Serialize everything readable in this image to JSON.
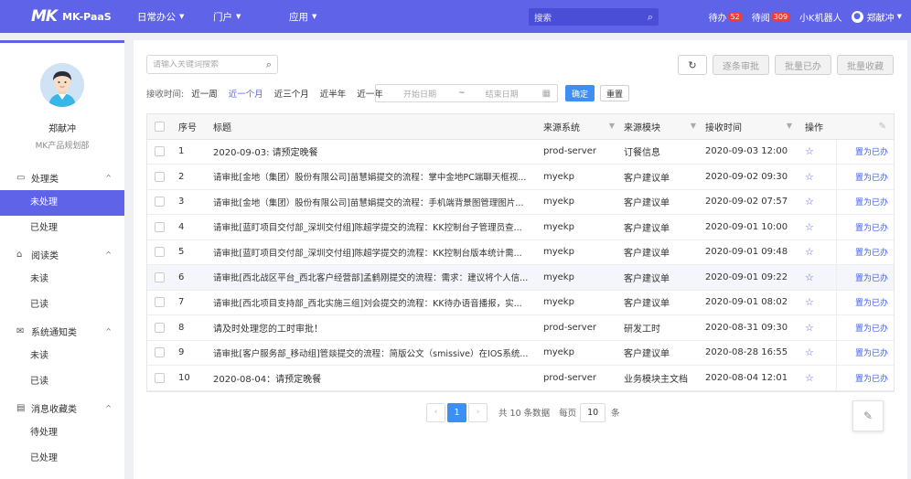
{
  "topbar": {
    "logo_mark": "MK",
    "logo_text": "MK-PaaS",
    "nav": [
      "日常办公",
      "门户",
      "应用"
    ],
    "search_placeholder": "搜索",
    "todo_label": "待办",
    "todo_count": "52",
    "toread_label": "待阅",
    "toread_count": "309",
    "robot_label": "小K机器人",
    "user_name": "郑献冲",
    "accent": "#5f63e8"
  },
  "profile": {
    "name": "郑献冲",
    "dept": "MK产品规划部"
  },
  "sidebar": {
    "groups": [
      {
        "icon": "monitor-icon",
        "label": "处理类",
        "items": [
          "未处理",
          "已处理"
        ]
      },
      {
        "icon": "home-icon",
        "label": "阅读类",
        "items": [
          "未读",
          "已读"
        ]
      },
      {
        "icon": "mail-icon",
        "label": "系统通知类",
        "items": [
          "未读",
          "已读"
        ]
      },
      {
        "icon": "doc-icon",
        "label": "消息收藏类",
        "items": [
          "待处理",
          "已处理"
        ]
      }
    ],
    "active": "未处理"
  },
  "toolbar": {
    "search_placeholder": "请输入关键词搜索",
    "btn_approve": "逐条审批",
    "btn_batch_done": "批量已办",
    "btn_batch_fav": "批量收藏"
  },
  "filter": {
    "label": "接收时间:",
    "options": [
      "近一周",
      "近一个月",
      "近三个月",
      "近半年",
      "近一年"
    ],
    "active": "近一个月",
    "start_placeholder": "开始日期",
    "separator": "~",
    "end_placeholder": "结束日期",
    "confirm": "确定",
    "reset": "重置"
  },
  "table": {
    "headers": [
      "序号",
      "标题",
      "来源系统",
      "来源模块",
      "接收时间",
      "操作"
    ],
    "rows": [
      {
        "idx": "1",
        "title": "2020-09-03: 请预定晚餐",
        "system": "prod-server",
        "module": "订餐信息",
        "time": "2020-09-03 12:00",
        "action": "置为已办"
      },
      {
        "idx": "2",
        "title": "请审批[金地（集团）股份有限公司]苗慧娟提交的流程：掌中金地PC端聊天框视...",
        "system": "myekp",
        "module": "客户建议单",
        "time": "2020-09-02 09:30",
        "action": "置为已办"
      },
      {
        "idx": "3",
        "title": "请审批[金地（集团）股份有限公司]苗慧娟提交的流程：手机端背景图管理图片...",
        "system": "myekp",
        "module": "客户建议单",
        "time": "2020-09-02 07:57",
        "action": "置为已办"
      },
      {
        "idx": "4",
        "title": "请审批[蓝盯项目交付部_深圳交付组]陈超学提交的流程：KK控制台子管理员查...",
        "system": "myekp",
        "module": "客户建议单",
        "time": "2020-09-01 10:00",
        "action": "置为已办"
      },
      {
        "idx": "5",
        "title": "请审批[蓝盯项目交付部_深圳交付组]陈超学提交的流程：KK控制台版本统计需...",
        "system": "myekp",
        "module": "客户建议单",
        "time": "2020-09-01 09:48",
        "action": "置为已办"
      },
      {
        "idx": "6",
        "title": "请审批[西北战区平台_西北客户经营部]孟鹤刚提交的流程：需求：建议将个人信...",
        "system": "myekp",
        "module": "客户建议单",
        "time": "2020-09-01 09:22",
        "action": "置为已办"
      },
      {
        "idx": "7",
        "title": "请审批[西北项目支持部_西北实施三组]刘会提交的流程：KK待办语音播报，实...",
        "system": "myekp",
        "module": "客户建议单",
        "time": "2020-09-01 08:02",
        "action": "置为已办"
      },
      {
        "idx": "8",
        "title": "请及时处理您的工时审批！",
        "system": "prod-server",
        "module": "研发工时",
        "time": "2020-08-31 09:30",
        "action": "置为已办"
      },
      {
        "idx": "9",
        "title": "请审批[客户服务部_移动组]管燚提交的流程：简版公文（smissive）在IOS系统...",
        "system": "myekp",
        "module": "客户建议单",
        "time": "2020-08-28 16:55",
        "action": "置为已办"
      },
      {
        "idx": "10",
        "title": "2020-08-04：请预定晚餐",
        "system": "prod-server",
        "module": "业务模块主文档",
        "time": "2020-08-04 12:01",
        "action": "置为已办"
      }
    ]
  },
  "pagination": {
    "current": "1",
    "total_text": "共 10 条数据",
    "size_label": "每页",
    "size": "10",
    "unit": "条"
  }
}
